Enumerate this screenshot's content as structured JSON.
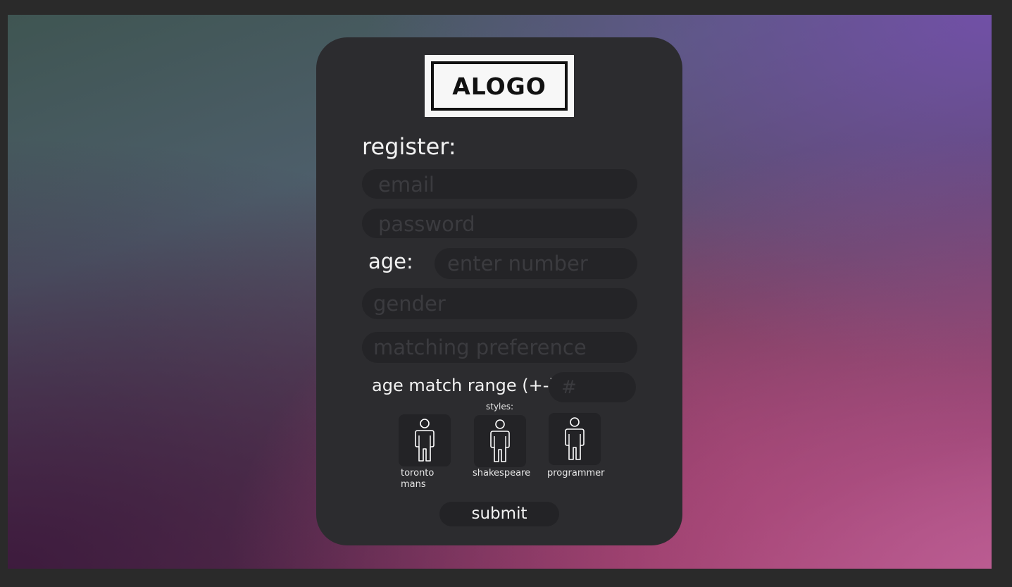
{
  "logo": {
    "text": "ALOGO"
  },
  "form": {
    "heading": "register:",
    "email_placeholder": "email",
    "password_placeholder": "password",
    "age_label": "age:",
    "age_placeholder": "enter number",
    "gender_placeholder": "gender",
    "matching_placeholder": "matching preference",
    "range_label": "age match range (+-):",
    "range_placeholder": "#",
    "styles_label": "styles:",
    "styles": [
      {
        "label": "toronto mans",
        "icon": "person-icon"
      },
      {
        "label": "shakespeare",
        "icon": "person-icon"
      },
      {
        "label": "programmer",
        "icon": "person-icon"
      }
    ],
    "submit_label": "submit"
  }
}
